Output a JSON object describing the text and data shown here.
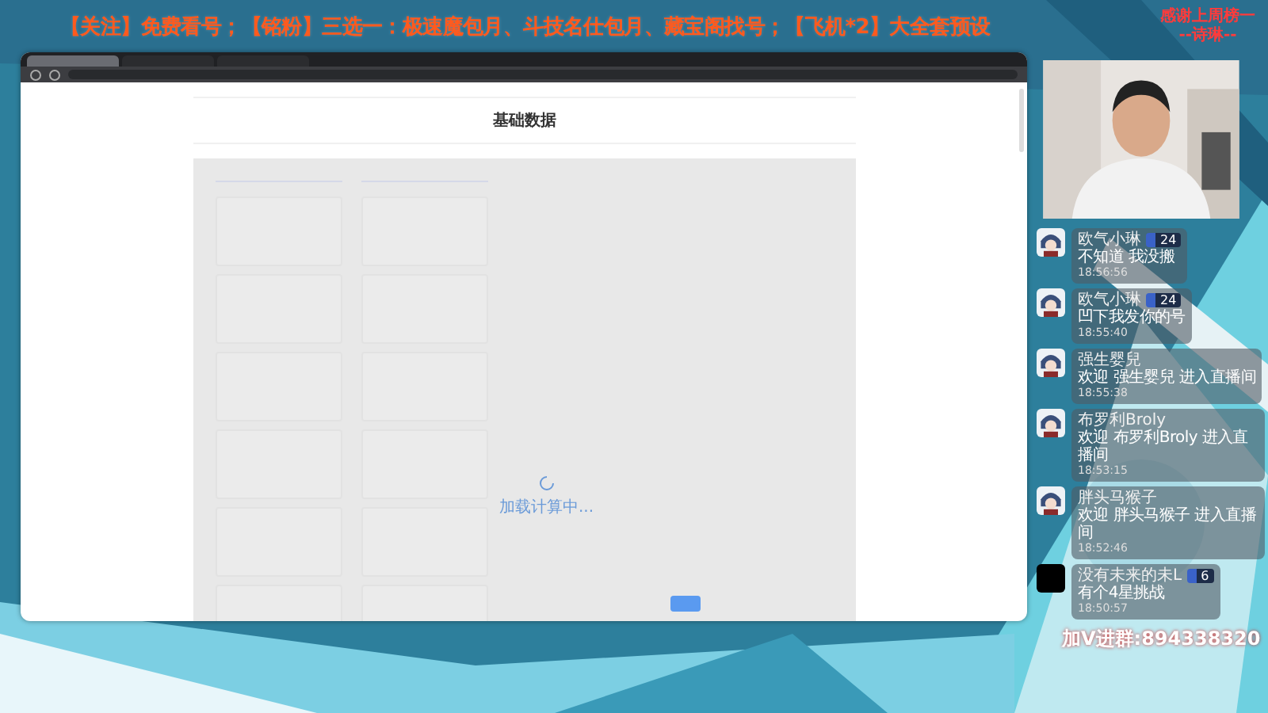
{
  "banner": {
    "text": "【关注】免费看号；【铭粉】三选一：极速魔包月、斗技名仕包月、藏宝阁找号；【飞机*2】大全套预设",
    "thanks": [
      "感谢上周榜一",
      "--诗琳--"
    ]
  },
  "browser": {
    "tabs": [
      {
        "selected": true
      },
      {
        "selected": false
      },
      {
        "selected": false
      }
    ],
    "page": {
      "title": "基础数据",
      "loading": "加载计算中...",
      "columns": [
        {
          "cards": [
            {
              "kind": "card"
            },
            {
              "kind": "card"
            },
            {
              "kind": "card"
            },
            {
              "kind": "card"
            },
            {
              "kind": "card"
            },
            {
              "kind": "card"
            }
          ]
        },
        {
          "cards": [
            {
              "kind": "card"
            },
            {
              "kind": "card"
            },
            {
              "kind": "card"
            },
            {
              "kind": "card"
            },
            {
              "kind": "card"
            },
            {
              "kind": "card"
            }
          ]
        }
      ]
    }
  },
  "chat": [
    {
      "kind": "art",
      "name": "欧气小琳",
      "badge": "24",
      "text": "不知道 我没搬",
      "time": "18:56:56"
    },
    {
      "kind": "art",
      "name": "欧气小琳",
      "badge": "24",
      "text": "凹下我发你的号",
      "time": "18:55:40"
    },
    {
      "kind": "art",
      "name": "强生婴兒",
      "text": "欢迎 强生婴兒 进入直播间",
      "time": "18:55:38"
    },
    {
      "kind": "art",
      "name": "布罗利Broly",
      "text": "欢迎 布罗利Broly 进入直播间",
      "time": "18:53:15"
    },
    {
      "kind": "art",
      "name": "胖头马猴子",
      "text": "欢迎 胖头马猴子 进入直播间",
      "time": "18:52:46"
    },
    {
      "kind": "dark",
      "name": "没有未来的未L",
      "badge": "6",
      "text": "有个4星挑战",
      "time": "18:50:57"
    }
  ],
  "contact": "加V进群:894338320"
}
